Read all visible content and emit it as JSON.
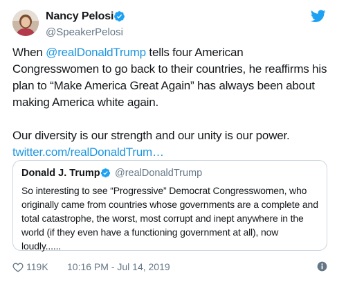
{
  "tweet": {
    "author": {
      "name": "Nancy Pelosi",
      "handle": "@SpeakerPelosi"
    },
    "text": {
      "intro": "When ",
      "mention": "@realDonaldTrump",
      "body": " tells four American Congresswomen to go back to their countries, he reaffirms his plan to “Make America Great Again” has always been about making America white again.",
      "second": "Our diversity is our strength and our unity is our power.",
      "link": "twitter.com/realDonaldTrum…"
    },
    "quoted": {
      "name": "Donald J. Trump",
      "handle": "@realDonaldTrump",
      "text": "So interesting to see “Progressive” Democrat Congresswomen, who originally came from countries whose governments are a complete and total catastrophe, the worst, most corrupt and inept anywhere in the world (if they even have a functioning government at all), now loudly......"
    },
    "footer": {
      "likes": "119K",
      "timestamp": "10:16 PM - Jul 14, 2019"
    }
  },
  "colors": {
    "link": "#1b95e0",
    "verified": "#1da1f2",
    "secondary": "#657786",
    "border": "#ccd6dd"
  },
  "icons": {
    "verified": "verified-badge-icon",
    "brand": "twitter-bird-icon",
    "like": "heart-icon",
    "info": "info-icon"
  }
}
